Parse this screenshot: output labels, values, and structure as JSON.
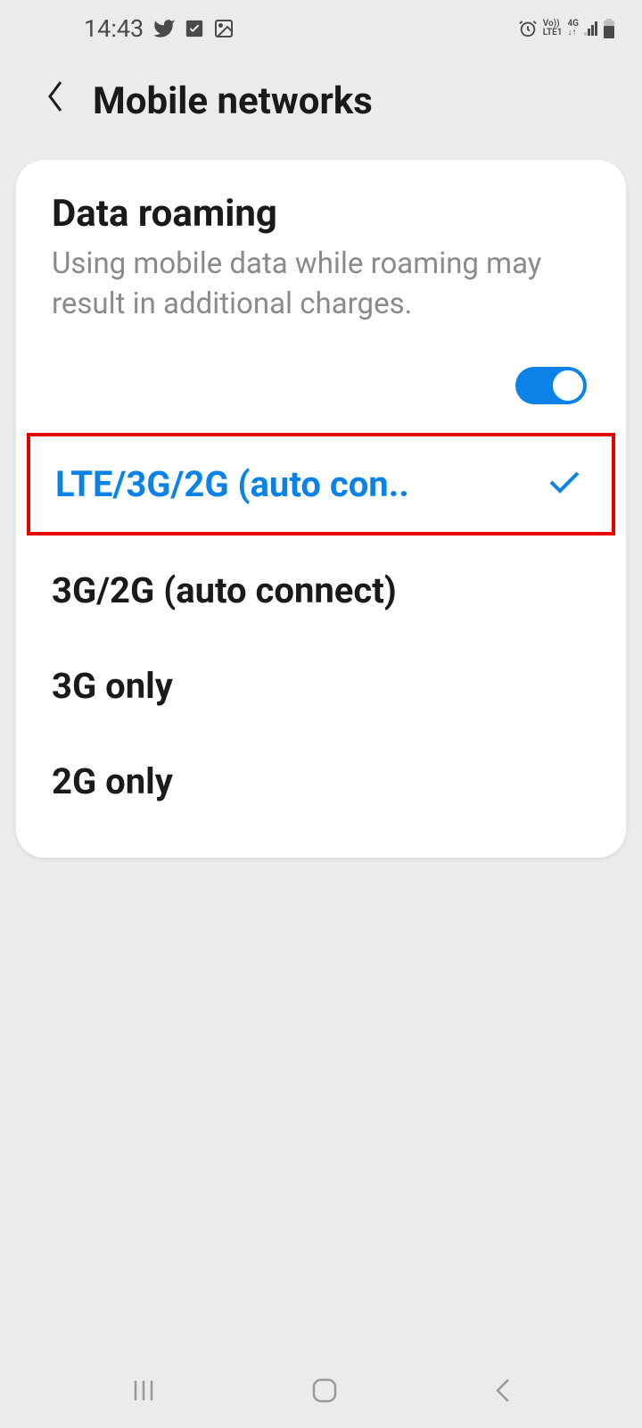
{
  "status_bar": {
    "time": "14:43"
  },
  "header": {
    "title": "Mobile networks"
  },
  "data_roaming": {
    "title": "Data roaming",
    "description": "Using mobile data while roaming may result in additional charges.",
    "enabled": true
  },
  "network_modes": {
    "selected": "LTE/3G/2G (auto con..",
    "options": [
      "3G/2G (auto connect)",
      "3G only",
      "2G only"
    ]
  }
}
